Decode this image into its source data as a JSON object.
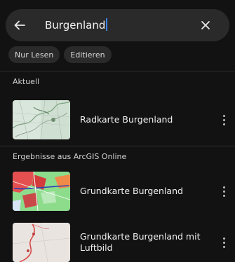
{
  "search": {
    "value": "Burgenland"
  },
  "filters": [
    {
      "label": "Nur Lesen"
    },
    {
      "label": "Editieren"
    }
  ],
  "sections": {
    "current": {
      "label": "Aktuell"
    },
    "results": {
      "label": "Ergebnisse aus ArcGIS Online"
    }
  },
  "items": [
    {
      "title": "Radkarte Burgenland",
      "thumbnail": "map-thumbnail"
    },
    {
      "title": "Grundkarte Burgenland",
      "thumbnail": "map-thumbnail"
    },
    {
      "title": "Grundkarte Burgenland mit Luftbild",
      "thumbnail": "map-thumbnail"
    }
  ],
  "colors": {
    "background": "#121212",
    "surface": "#2a2a2a",
    "caret": "#3b82f6"
  },
  "icons": {
    "back": "arrow-left-icon",
    "clear": "close-icon",
    "more": "more-vertical-icon"
  }
}
